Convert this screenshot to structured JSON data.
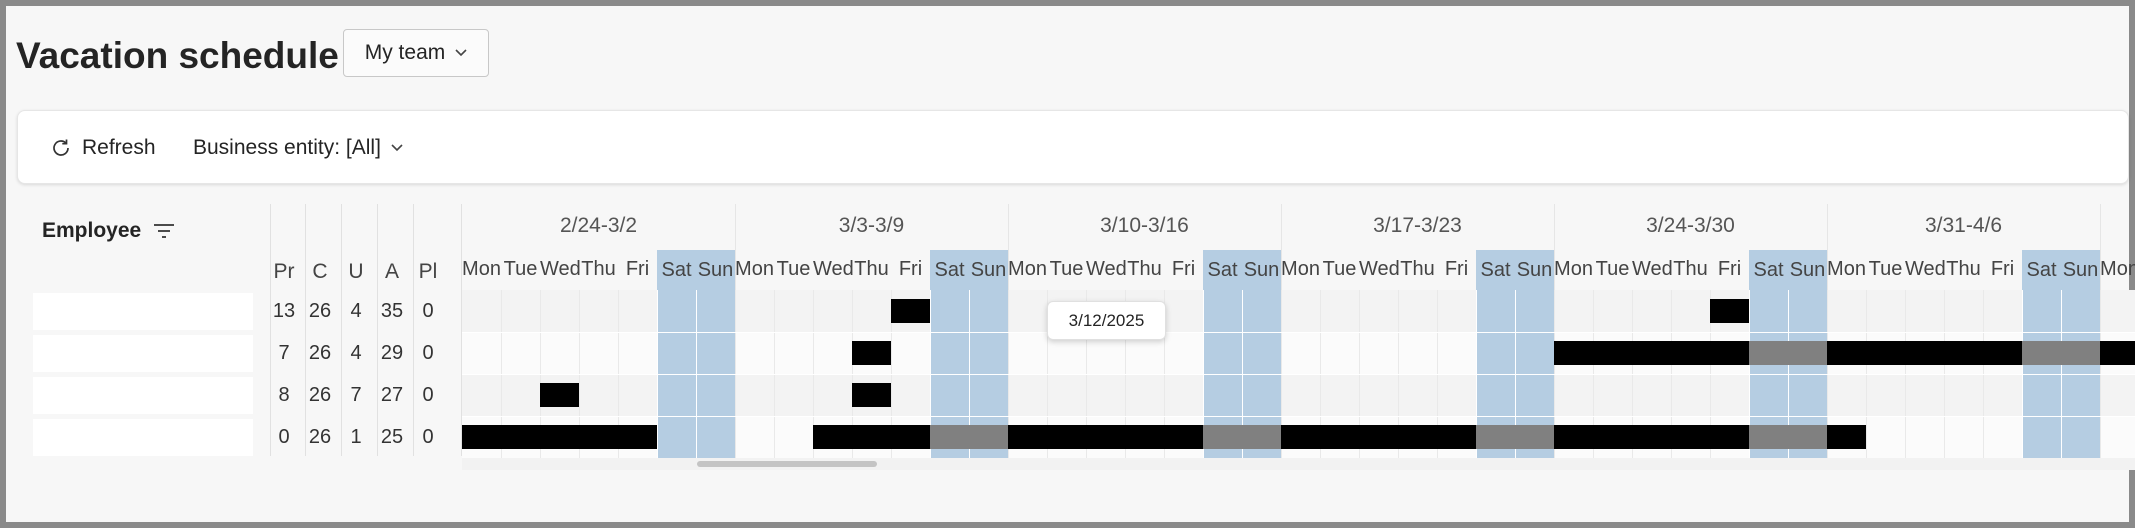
{
  "page": {
    "title": "Vacation schedule"
  },
  "team_select": {
    "value": "My team"
  },
  "toolbar": {
    "refresh_label": "Refresh",
    "business_entity_label": "Business entity: [All]"
  },
  "grid": {
    "employee_header": "Employee",
    "stat_headers": [
      "Pr",
      "C",
      "U",
      "A",
      "Pl"
    ],
    "rows": [
      {
        "name": "",
        "stats": [
          "13",
          "26",
          "4",
          "35",
          "0"
        ]
      },
      {
        "name": "",
        "stats": [
          "7",
          "26",
          "4",
          "29",
          "0"
        ]
      },
      {
        "name": "",
        "stats": [
          "8",
          "26",
          "7",
          "27",
          "0"
        ]
      },
      {
        "name": "",
        "stats": [
          "0",
          "26",
          "1",
          "25",
          "0"
        ]
      }
    ],
    "weeks": [
      "2/24-3/2",
      "3/3-3/9",
      "3/10-3/16",
      "3/17-3/23",
      "3/24-3/30",
      "3/31-4/6"
    ],
    "day_labels": [
      "Mon",
      "Tue",
      "Wed",
      "Thu",
      "Fri",
      "Sat",
      "Sun"
    ],
    "trailing_day_label": "Mon",
    "vacations": [
      {
        "row": 0,
        "from_day": 11,
        "to_day": 11
      },
      {
        "row": 0,
        "from_day": 32,
        "to_day": 32
      },
      {
        "row": 1,
        "from_day": 10,
        "to_day": 10
      },
      {
        "row": 1,
        "from_day": 28,
        "to_day": 42
      },
      {
        "row": 2,
        "from_day": 2,
        "to_day": 2
      },
      {
        "row": 2,
        "from_day": 10,
        "to_day": 10
      },
      {
        "row": 3,
        "from_day": 0,
        "to_day": 4
      },
      {
        "row": 3,
        "from_day": 9,
        "to_day": 35
      }
    ],
    "tooltip": "3/12/2025"
  },
  "colors": {
    "weekend": "#b5cde2",
    "vacation": "#000000",
    "vacation_weekend": "#808080"
  }
}
